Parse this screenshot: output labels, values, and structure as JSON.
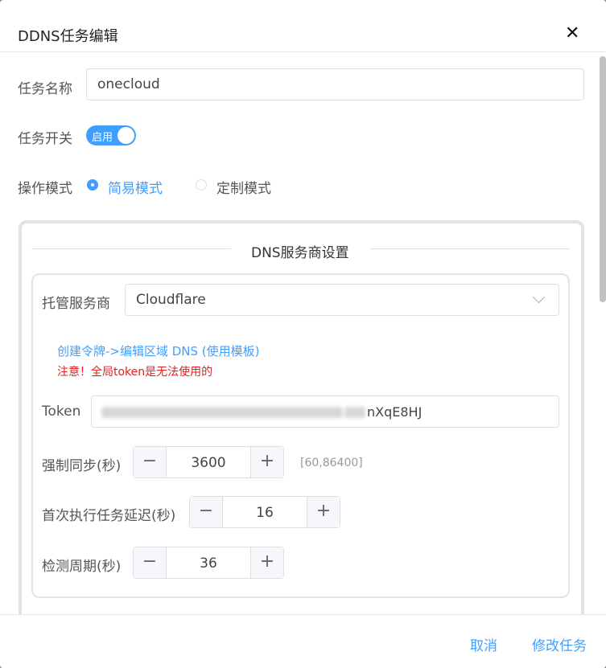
{
  "dialog": {
    "title": "DDNS任务编辑",
    "close_icon": "✕"
  },
  "form": {
    "task_name_label": "任务名称",
    "task_name_value": "onecloud",
    "switch_label": "任务开关",
    "switch_text": "启用",
    "switch_on": true,
    "mode_label": "操作模式",
    "mode_simple": "简易模式",
    "mode_custom": "定制模式",
    "mode_selected": "简易模式"
  },
  "dns": {
    "section_title": "DNS服务商设置",
    "provider_label": "托管服务商",
    "provider_value": "Cloudflare",
    "link_text": "创建令牌->编辑区域 DNS (使用模板)",
    "warning_text": "注意！全局token是无法使用的",
    "token_label": "Token",
    "token_visible_tail": "nXqE8HJ",
    "force_sync_label": "强制同步(秒)",
    "force_sync_value": "3600",
    "force_sync_range": "[60,86400]",
    "first_delay_label": "首次执行任务延迟(秒)",
    "first_delay_value": "16",
    "interval_label": "检测周期(秒)",
    "interval_value": "36",
    "minus": "−",
    "plus": "+"
  },
  "footer": {
    "cancel": "取消",
    "submit": "修改任务"
  },
  "colors": {
    "accent": "#409eff",
    "warning": "#e02020"
  }
}
